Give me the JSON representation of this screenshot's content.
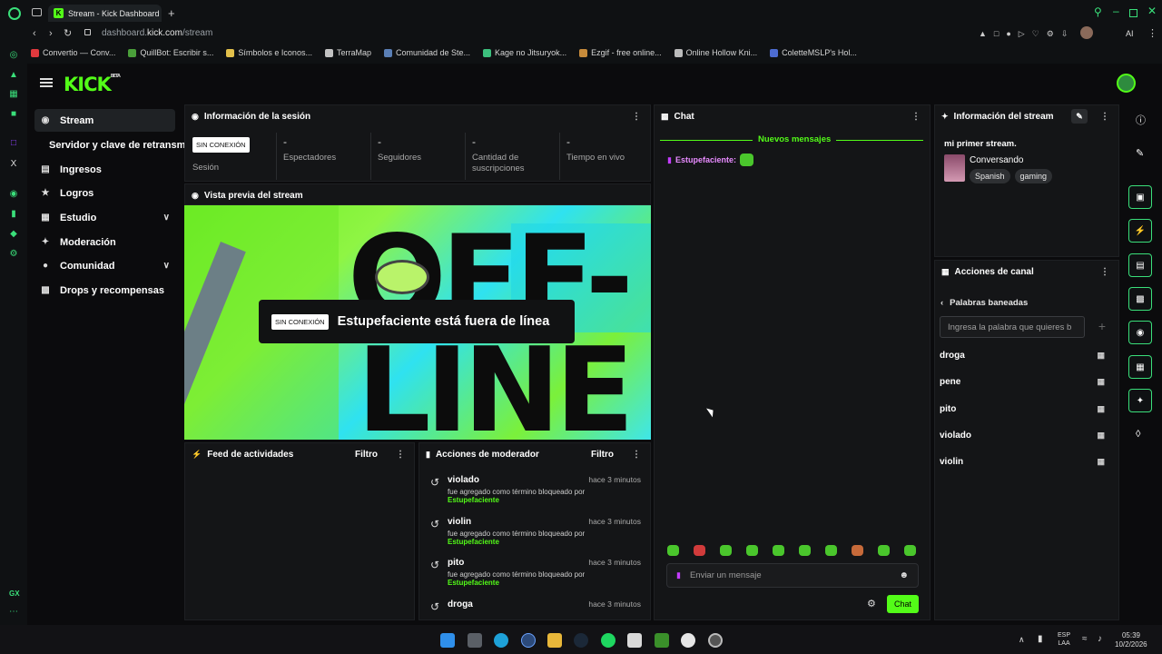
{
  "browser": {
    "tab_title": "Stream - Kick Dashboard",
    "tab_icon": "K",
    "address_host": "dashboard.",
    "address_domain": "kick.com",
    "address_path": "/stream",
    "ai_label": "AI",
    "gx_label": "GX",
    "bookmarks": [
      {
        "label": "Convertio — Conv...",
        "color": "#e0393e"
      },
      {
        "label": "QuillBot: Escribir s...",
        "color": "#4a9f3a"
      },
      {
        "label": "Símbolos e Iconos...",
        "color": "#e2c04b"
      },
      {
        "label": "TerraMap",
        "color": "#c2c2c2"
      },
      {
        "label": "Comunidad de Ste...",
        "color": "#5a7fb6"
      },
      {
        "label": "Kage no Jitsuryok...",
        "color": "#3cbf7d"
      },
      {
        "label": "Ezgif - free online...",
        "color": "#c78b3b"
      },
      {
        "label": "Online Hollow Kni...",
        "color": "#bbbbbb"
      },
      {
        "label": "ColetteMSLP's Hol...",
        "color": "#4d6cd1"
      }
    ]
  },
  "brand": {
    "logo": "KICK",
    "beta": "BETA"
  },
  "sidebar": {
    "items": [
      {
        "label": "Stream",
        "icon": "broadcast-icon"
      },
      {
        "label": "Servidor y clave de retransmisi",
        "icon": ""
      },
      {
        "label": "Ingresos",
        "icon": "chart-icon"
      },
      {
        "label": "Logros",
        "icon": "trophy-icon"
      },
      {
        "label": "Estudio",
        "icon": "brush-icon"
      },
      {
        "label": "Moderación",
        "icon": "wrench-icon"
      },
      {
        "label": "Comunidad",
        "icon": "people-icon"
      },
      {
        "label": "Drops y recompensas",
        "icon": "gift-icon"
      }
    ]
  },
  "session": {
    "title": "Información de la sesión",
    "status_badge": "SIN CONEXIÓN",
    "session_label": "Sesión",
    "stats": [
      {
        "value": "-",
        "label": "Espectadores"
      },
      {
        "value": "-",
        "label": "Seguidores"
      },
      {
        "value": "-",
        "label": "Cantidad de suscripciones"
      },
      {
        "value": "-",
        "label": "Tiempo en vivo"
      }
    ]
  },
  "preview": {
    "title": "Vista previa del stream",
    "badge": "SIN CONEXIÓN",
    "message": "Estupefaciente está fuera de línea",
    "art_line1": "OFF-",
    "art_line2": "LINE"
  },
  "activity": {
    "title": "Feed de actividades",
    "filter": "Filtro"
  },
  "mod_actions": {
    "title": "Acciones de moderador",
    "filter": "Filtro",
    "items": [
      {
        "word": "violado",
        "time": "hace 3 minutos",
        "desc": "fue agregado como término bloqueado por",
        "user": "Estupefaciente"
      },
      {
        "word": "violin",
        "time": "hace 3 minutos",
        "desc": "fue agregado como término bloqueado por",
        "user": "Estupefaciente"
      },
      {
        "word": "pito",
        "time": "hace 3 minutos",
        "desc": "fue agregado como término bloqueado por",
        "user": "Estupefaciente"
      },
      {
        "word": "droga",
        "time": "hace 3 minutos",
        "desc": "",
        "user": ""
      }
    ]
  },
  "chat": {
    "title": "Chat",
    "new_messages": "Nuevos mensajes",
    "message_user": "Estupefaciente:",
    "input_placeholder": "Enviar un mensaje",
    "send_label": "Chat",
    "emote_count": 10
  },
  "stream_info": {
    "title": "Información del stream",
    "stream_title": "mi primer stream.",
    "category": "Conversando",
    "tags": [
      "Spanish",
      "gaming"
    ]
  },
  "channel_actions": {
    "title": "Acciones de canal",
    "section": "Palabras baneadas",
    "input_placeholder": "Ingresa la palabra que quieres b",
    "banned_words": [
      "droga",
      "pene",
      "pito",
      "violado",
      "violin"
    ]
  },
  "taskbar": {
    "lang_top": "ESP",
    "lang_bottom": "LAA",
    "time": "05:39",
    "date": "10/2/2026"
  },
  "colors": {
    "accent": "#53fc18",
    "rail": "#3adf7a"
  }
}
